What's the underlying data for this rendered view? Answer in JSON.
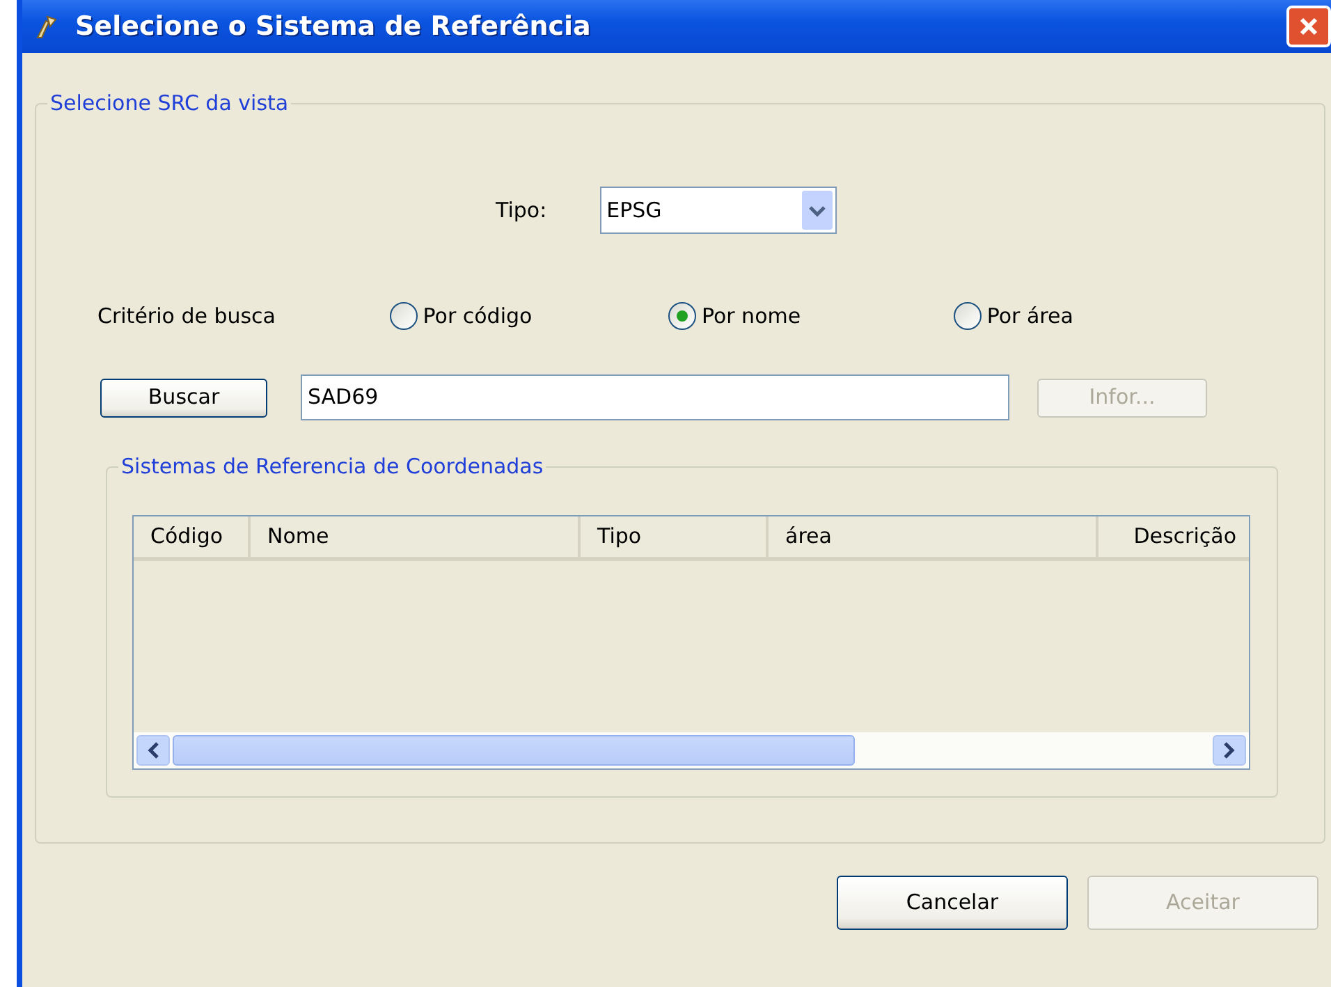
{
  "window": {
    "title": "Selecione o Sistema de Referência"
  },
  "group": {
    "legend": "Selecione SRC da vista"
  },
  "type_field": {
    "label": "Tipo:",
    "value": "EPSG"
  },
  "search_criteria": {
    "label": "Critério de busca",
    "options": [
      {
        "label": "Por código",
        "selected": false
      },
      {
        "label": "Por nome",
        "selected": true
      },
      {
        "label": "Por área",
        "selected": false
      }
    ]
  },
  "search": {
    "button": "Buscar",
    "value": "SAD69",
    "info_button": {
      "label": "Infor...",
      "disabled": true
    }
  },
  "results": {
    "legend": "Sistemas de Referencia de Coordenadas",
    "columns": [
      "Código",
      "Nome",
      "Tipo",
      "área",
      "Descrição"
    ]
  },
  "buttons": [
    {
      "label": "Cancelar",
      "disabled": false
    },
    {
      "label": "Aceitar",
      "disabled": true
    }
  ]
}
